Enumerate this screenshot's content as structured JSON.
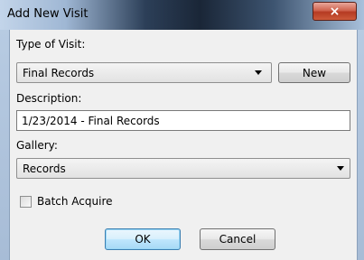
{
  "window": {
    "title": "Add New Visit",
    "close_label": "×"
  },
  "form": {
    "type_label": "Type of Visit:",
    "type_value": "Final Records",
    "new_button": "New",
    "description_label": "Description:",
    "description_value": "1/23/2014 - Final Records",
    "gallery_label": "Gallery:",
    "gallery_value": "Records",
    "batch_label": "Batch Acquire",
    "batch_checked": false
  },
  "buttons": {
    "ok": "OK",
    "cancel": "Cancel"
  }
}
